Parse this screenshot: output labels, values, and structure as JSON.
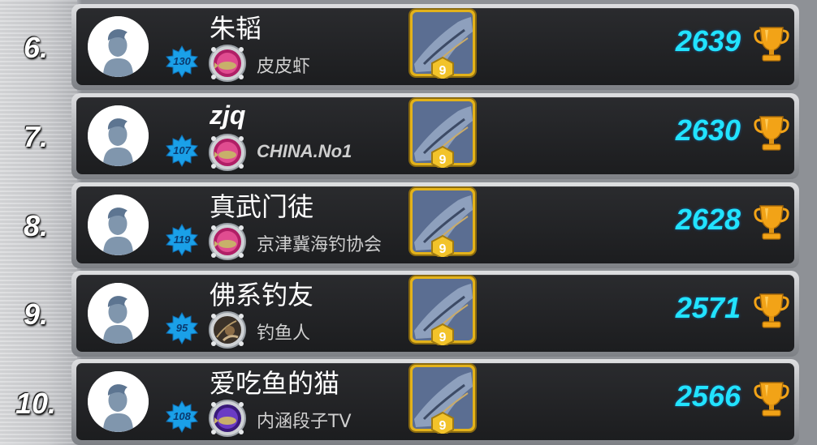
{
  "colors": {
    "score": "#22e3ff",
    "level_badge": "#1aa0e8",
    "card_border": "#e3b21a",
    "trophy": "#f2a317",
    "row_bg": "#1c1d1f"
  },
  "rows": [
    {
      "rank": "6.",
      "level": "130",
      "name": "朱韬",
      "guild": "皮皮虾",
      "fish_level": "9",
      "score": "2639",
      "avatar_icon": "default-avatar-icon",
      "emblem_icon": "pink-fish-emblem-icon",
      "trophy_icon": "trophy-icon"
    },
    {
      "rank": "7.",
      "level": "107",
      "name": "zjq",
      "guild": "CHINA.No1",
      "fish_level": "9",
      "score": "2630",
      "avatar_icon": "default-avatar-icon",
      "emblem_icon": "pink-fish-emblem-icon",
      "trophy_icon": "trophy-icon"
    },
    {
      "rank": "8.",
      "level": "119",
      "name": "真武门徒",
      "guild": "京津冀海钓协会",
      "fish_level": "9",
      "score": "2628",
      "avatar_icon": "default-avatar-icon",
      "emblem_icon": "pink-fish-emblem-icon",
      "trophy_icon": "trophy-icon"
    },
    {
      "rank": "9.",
      "level": "95",
      "name": "佛系钓友",
      "guild": "钓鱼人",
      "fish_level": "9",
      "score": "2571",
      "avatar_icon": "default-avatar-icon",
      "emblem_icon": "fisherman-emblem-icon",
      "trophy_icon": "trophy-icon"
    },
    {
      "rank": "10.",
      "level": "108",
      "name": "爱吃鱼的猫",
      "guild": "内涵段子TV",
      "fish_level": "9",
      "score": "2566",
      "avatar_icon": "default-avatar-icon",
      "emblem_icon": "purple-fish-emblem-icon",
      "trophy_icon": "trophy-icon"
    }
  ]
}
